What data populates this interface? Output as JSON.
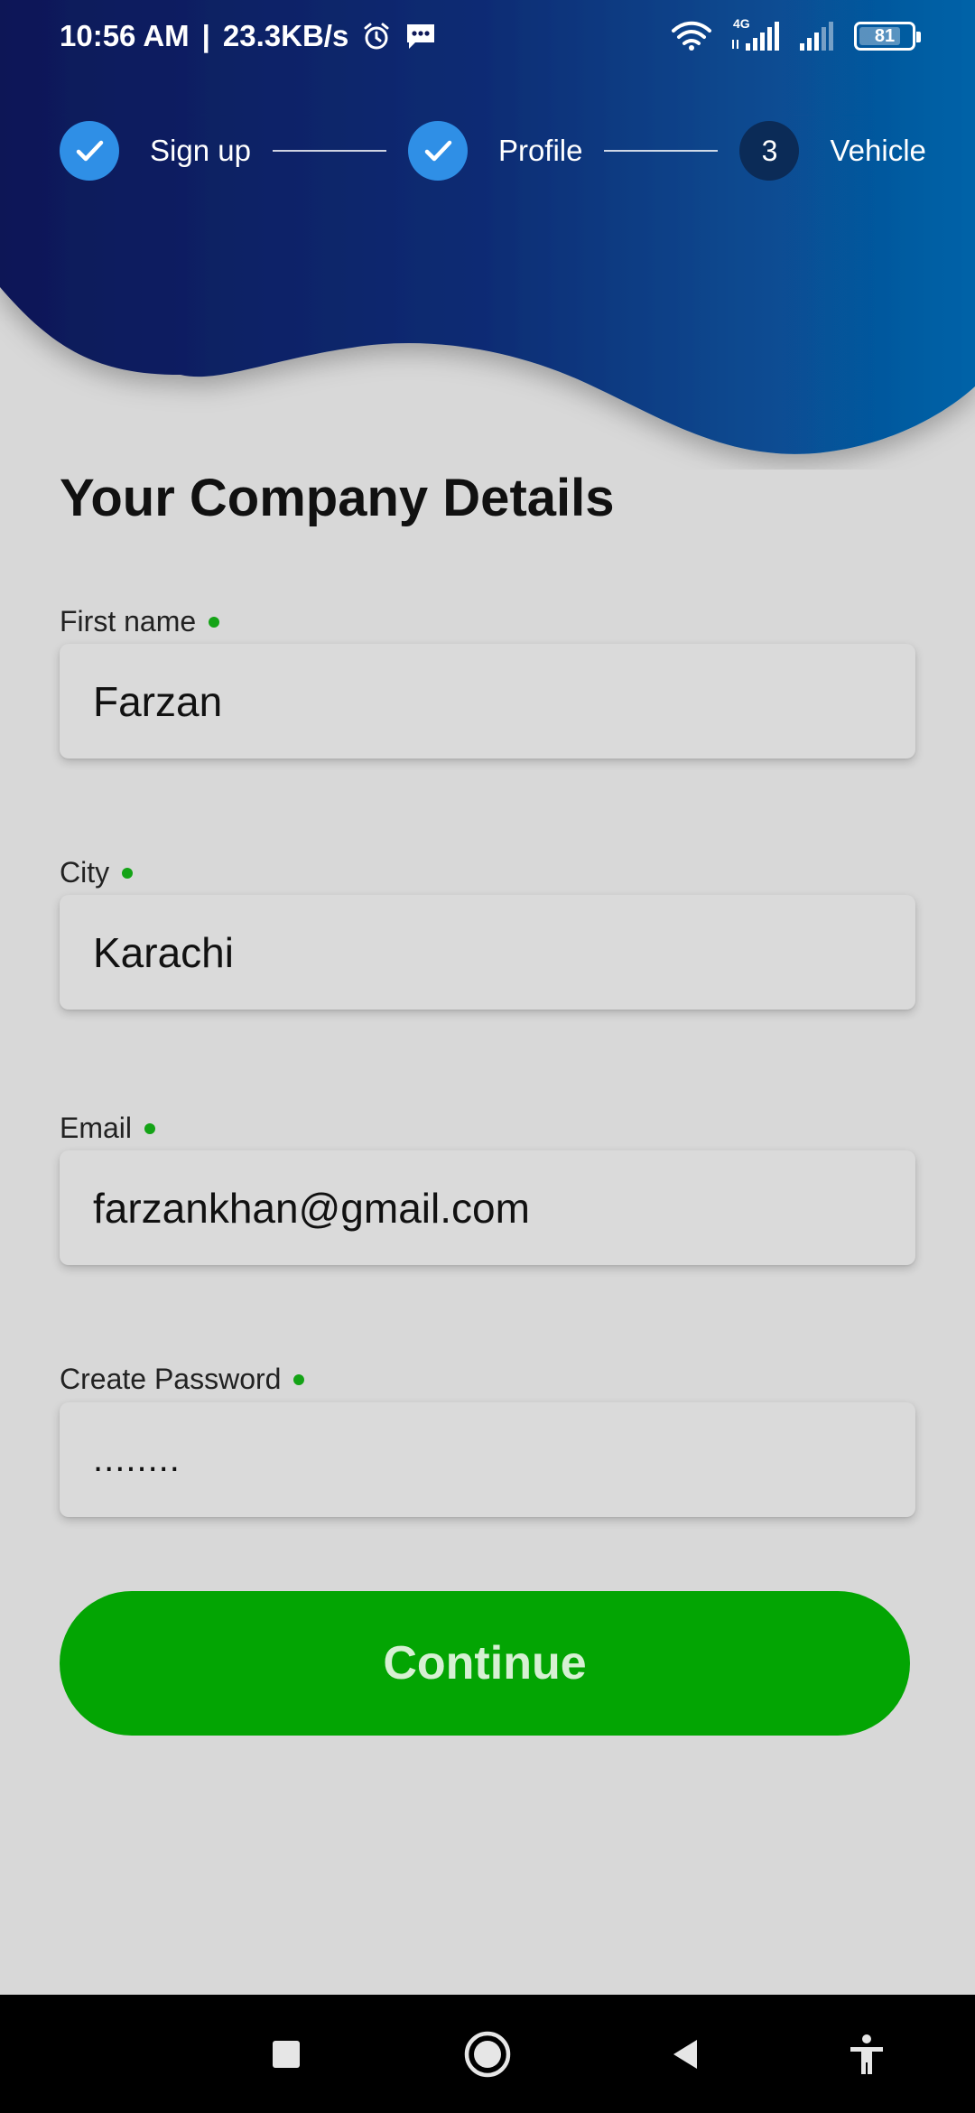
{
  "status_bar": {
    "time": "10:56 AM",
    "separator": "|",
    "speed": "23.3KB/s",
    "network": "4G",
    "battery": "81"
  },
  "stepper": {
    "steps": [
      {
        "label": "Sign up",
        "state": "done"
      },
      {
        "label": "Profile",
        "state": "done"
      },
      {
        "label": "Vehicle",
        "state": "current",
        "number": "3"
      }
    ]
  },
  "page": {
    "title": "Your Company Details"
  },
  "form": {
    "first_name": {
      "label": "First name",
      "value": "Farzan"
    },
    "city": {
      "label": "City",
      "value": "Karachi"
    },
    "email": {
      "label": "Email",
      "value": "farzankhan@gmail.com"
    },
    "password": {
      "label": "Create Password",
      "value": "........"
    }
  },
  "actions": {
    "continue_label": "Continue"
  },
  "colors": {
    "header_dark": "#0d1757",
    "header_light": "#0563a8",
    "step_done": "#2f8fe6",
    "step_current": "#0b2b57",
    "accent_green": "#03a503",
    "background": "#d8d8d8"
  }
}
